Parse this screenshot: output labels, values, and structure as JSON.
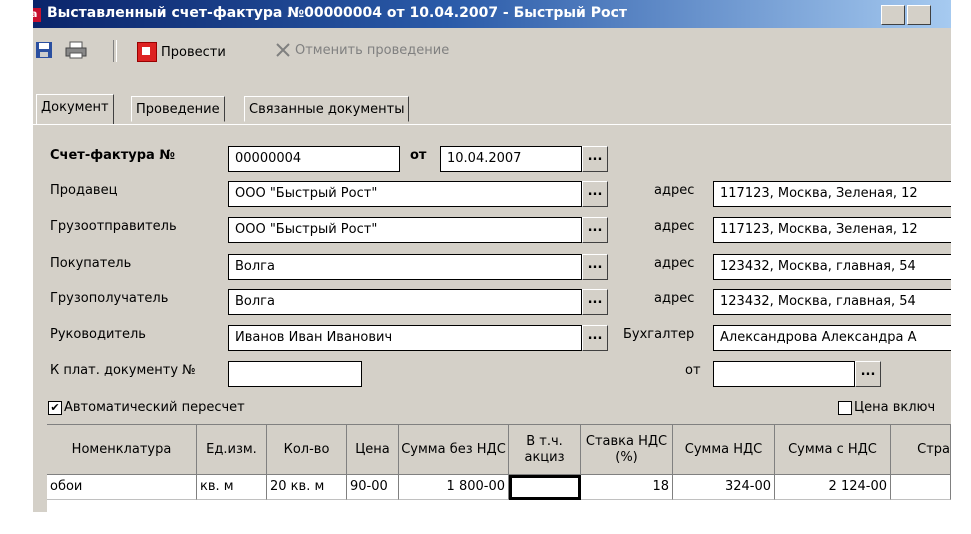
{
  "window": {
    "title": "Выставленный счет-фактура №00000004 от 10.04.2007 - Быстрый Рост",
    "icon_letter": "a"
  },
  "toolbar": {
    "post_label": "Провести",
    "cancel_label": "Отменить проведение"
  },
  "tabs": [
    {
      "label": "Документ"
    },
    {
      "label": "Проведение"
    },
    {
      "label": "Связанные документы"
    }
  ],
  "form": {
    "invoice_label": "Счет-фактура №",
    "invoice_number": "00000004",
    "date_label": "от",
    "date_value": "10.04.2007",
    "seller_label": "Продавец",
    "seller_value": "ООО \"Быстрый Рост\"",
    "shipper_label": "Грузоотправитель",
    "shipper_value": "ООО \"Быстрый Рост\"",
    "buyer_label": "Покупатель",
    "buyer_value": "Волга",
    "consignee_label": "Грузополучатель",
    "consignee_value": "Волга",
    "manager_label": "Руководитель",
    "manager_value": "Иванов Иван Иванович",
    "payment_doc_label": "К плат. документу №",
    "payment_doc_value": "",
    "address_label": "адрес",
    "seller_address": "117123, Москва, Зеленая, 12",
    "shipper_address": "117123, Москва, Зеленая, 12",
    "buyer_address": "123432, Москва, главная, 54",
    "consignee_address": "123432, Москва, главная, 54",
    "accountant_label": "Бухгалтер",
    "accountant_value": "Александрова Александра А",
    "pay_date_label": "от",
    "pay_date_value": "",
    "dots": "...",
    "auto_recalc_label": "Автоматический пересчет",
    "auto_recalc_checked": true,
    "price_incl_label": "Цена включ",
    "price_incl_checked": false
  },
  "grid": {
    "headers": [
      "Номенклатура",
      "Ед.изм.",
      "Кол-во",
      "Цена",
      "Сумма без НДС",
      "В т.ч. акциз",
      "Ставка НДС (%)",
      "Сумма НДС",
      "Сумма с НДС",
      "Стра"
    ],
    "rows": [
      [
        "обои",
        "кв. м",
        "20 кв. м",
        "90-00",
        "1 800-00",
        "",
        "18",
        "324-00",
        "2 124-00",
        ""
      ]
    ]
  },
  "colors": {
    "titlebar_start": "#0a246a",
    "titlebar_end": "#a6caf0",
    "face": "#d4d0c8"
  }
}
